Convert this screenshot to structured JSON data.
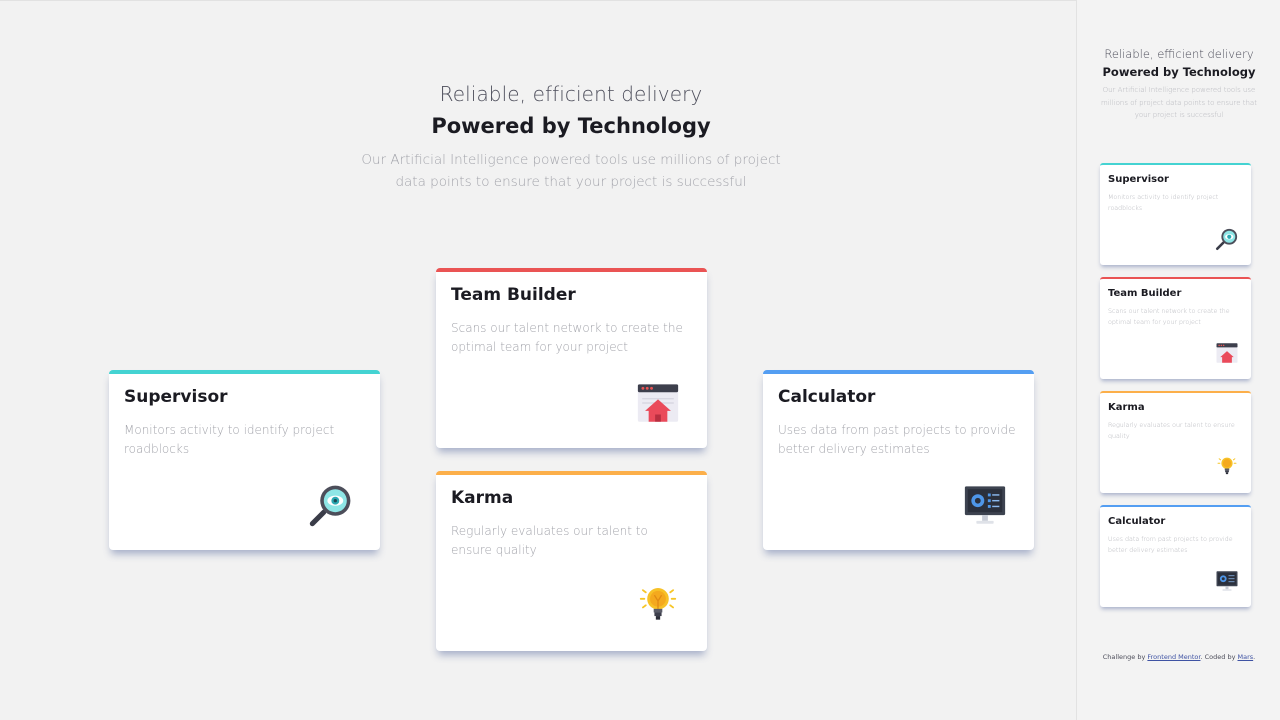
{
  "header": {
    "subtitle": "Reliable, efficient delivery",
    "title": "Powered by Technology",
    "description": "Our Artificial Intelligence powered tools use millions of project data points to ensure that your project is successful"
  },
  "cards": [
    {
      "title": "Supervisor",
      "description": "Monitors activity to identify project roadblocks",
      "icon": "magnifier-eye-icon",
      "accent": "#44d3d2"
    },
    {
      "title": "Team Builder",
      "description": "Scans our talent network to create the optimal team for your project",
      "icon": "browser-house-icon",
      "accent": "#ea5454"
    },
    {
      "title": "Karma",
      "description": "Regularly evaluates our talent to ensure quality",
      "icon": "lightbulb-icon",
      "accent": "#fcaf4a"
    },
    {
      "title": "Calculator",
      "description": "Uses data from past projects to provide better delivery estimates",
      "icon": "monitor-dashboard-icon",
      "accent": "#549ef2"
    }
  ],
  "attribution": {
    "prefix": "Challenge by",
    "link1": "Frontend Mentor",
    "middle": ". Coded by",
    "link2": "Mars",
    "suffix": "."
  }
}
